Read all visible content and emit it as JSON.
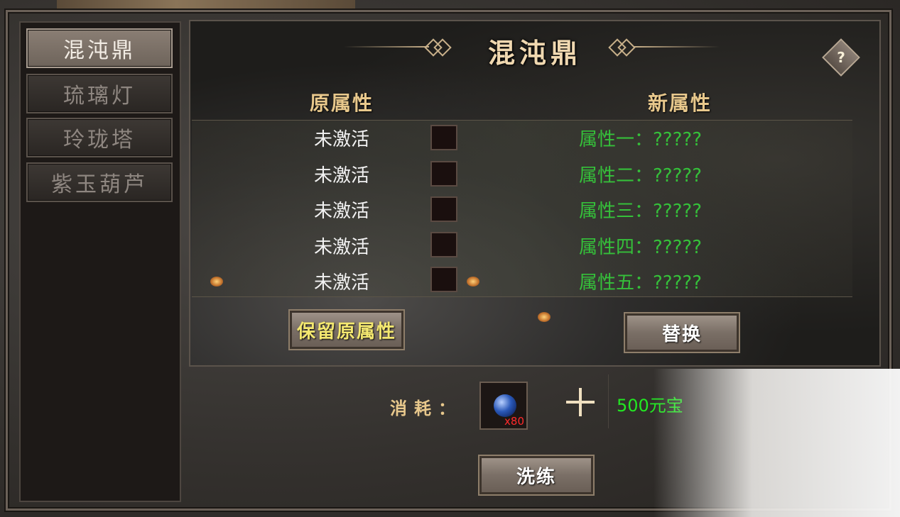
{
  "sidebar": {
    "items": [
      {
        "label": "混沌鼎"
      },
      {
        "label": "琉璃灯"
      },
      {
        "label": "玲珑塔"
      },
      {
        "label": "紫玉葫芦"
      }
    ]
  },
  "panel": {
    "title": "混沌鼎",
    "help": "?",
    "old_header": "原属性",
    "new_header": "新属性",
    "old_values": [
      "未激活",
      "未激活",
      "未激活",
      "未激活",
      "未激活"
    ],
    "new_values": [
      "属性一：?????",
      "属性二：?????",
      "属性三：?????",
      "属性四：?????",
      "属性五：?????"
    ],
    "keep_button": "保留原属性",
    "replace_button": "替换"
  },
  "cost": {
    "label": "消耗：",
    "item_count": "x80",
    "currency": "500元宝"
  },
  "refine_button": "洗练",
  "colors": {
    "new_attr": "#35c03a",
    "header": "#e8c88c",
    "item_count": "#ff2a2a",
    "currency": "#22e822"
  }
}
